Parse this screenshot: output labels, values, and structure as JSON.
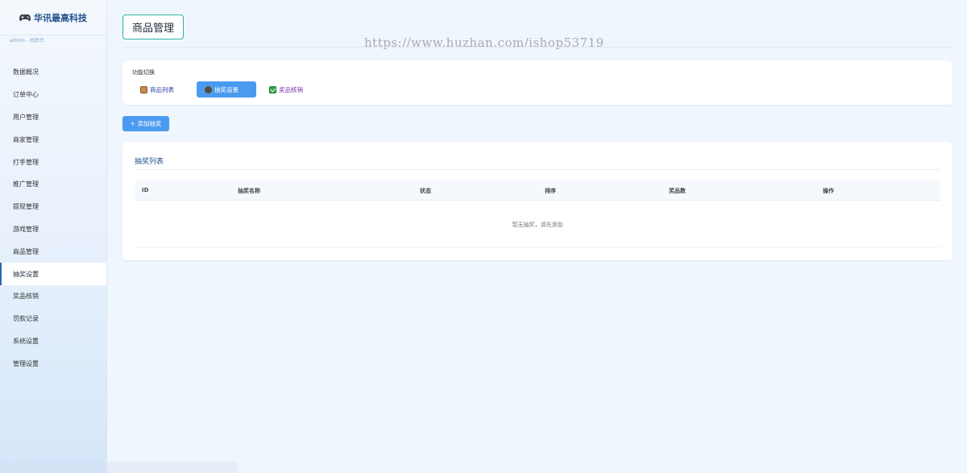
{
  "brand": {
    "name": "华讯最高科技",
    "icon": "gamepad-icon"
  },
  "admin_info": "admin - 总后台",
  "sidebar": {
    "items": [
      {
        "label": "数据概况",
        "active": false
      },
      {
        "label": "订单中心",
        "active": false
      },
      {
        "label": "用户管理",
        "active": false
      },
      {
        "label": "商家管理",
        "active": false
      },
      {
        "label": "打手管理",
        "active": false
      },
      {
        "label": "推广管理",
        "active": false
      },
      {
        "label": "提现管理",
        "active": false
      },
      {
        "label": "游戏管理",
        "active": false
      },
      {
        "label": "商品管理",
        "active": false
      },
      {
        "label": "抽奖设置",
        "active": true
      },
      {
        "label": "奖品核销",
        "active": false
      },
      {
        "label": "罚款记录",
        "active": false
      },
      {
        "label": "系统设置",
        "active": false
      },
      {
        "label": "管理设置",
        "active": false
      }
    ]
  },
  "page": {
    "title": "商品管理"
  },
  "watermark": "https://www.huzhan.com/ishop53719",
  "switcher": {
    "label": "功能切换",
    "buttons": [
      {
        "label": "商品列表",
        "icon": "package-icon"
      },
      {
        "label": "抽奖设置",
        "icon": "prize-icon"
      },
      {
        "label": "奖品核销",
        "icon": "check-icon"
      }
    ]
  },
  "add_button": "+ 添加抽奖",
  "lottery_list": {
    "title": "抽奖列表",
    "columns": [
      "ID",
      "抽奖名称",
      "状态",
      "排序",
      "奖品数",
      "操作"
    ],
    "empty_text": "暂无抽奖，请先添加"
  },
  "colors": {
    "accent": "#4a9bf0",
    "brand_text": "#1e4f8a",
    "title_border": "#2bb3a5"
  }
}
